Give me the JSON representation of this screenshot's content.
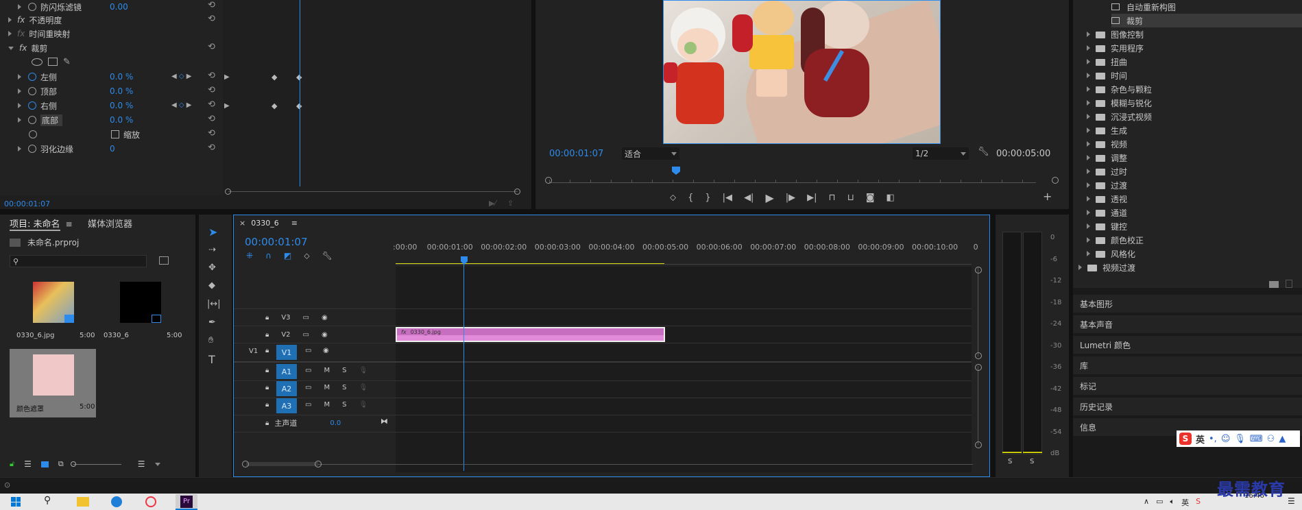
{
  "effect_controls": {
    "rows": [
      {
        "label": "防闪烁滤镜",
        "value": "0.00"
      },
      {
        "label": "不透明度"
      },
      {
        "label": "时间重映射"
      },
      {
        "label": "裁剪"
      },
      {
        "label": "左侧",
        "value": "0.0 %"
      },
      {
        "label": "顶部",
        "value": "0.0 %"
      },
      {
        "label": "右侧",
        "value": "0.0 %"
      },
      {
        "label": "底部",
        "value": "0.0 %"
      },
      {
        "label": "缩放"
      },
      {
        "label": "羽化边缘",
        "value": "0"
      }
    ],
    "timecode": "00:00:01:07",
    "fx_label": "fx"
  },
  "program_monitor": {
    "timecode": "00:00:01:07",
    "fit": "适合",
    "resolution": "1/2",
    "duration": "00:00:05:00"
  },
  "effects_panel": {
    "items": [
      {
        "label": "自动重新构图",
        "level": 2
      },
      {
        "label": "裁剪",
        "level": 2
      },
      {
        "label": "图像控制",
        "level": 1
      },
      {
        "label": "实用程序",
        "level": 1
      },
      {
        "label": "扭曲",
        "level": 1
      },
      {
        "label": "时间",
        "level": 1
      },
      {
        "label": "杂色与颗粒",
        "level": 1
      },
      {
        "label": "模糊与锐化",
        "level": 1
      },
      {
        "label": "沉浸式视频",
        "level": 1
      },
      {
        "label": "生成",
        "level": 1
      },
      {
        "label": "视频",
        "level": 1
      },
      {
        "label": "调整",
        "level": 1
      },
      {
        "label": "过时",
        "level": 1
      },
      {
        "label": "过渡",
        "level": 1
      },
      {
        "label": "透视",
        "level": 1
      },
      {
        "label": "通道",
        "level": 1
      },
      {
        "label": "键控",
        "level": 1
      },
      {
        "label": "颜色校正",
        "level": 1
      },
      {
        "label": "风格化",
        "level": 1
      },
      {
        "label": "视频过渡",
        "level": 0
      }
    ],
    "sections": [
      "基本图形",
      "基本声音",
      "Lumetri 颜色",
      "库",
      "标记",
      "历史记录",
      "信息"
    ]
  },
  "project_panel": {
    "tabs": [
      "项目: 未命名",
      "媒体浏览器"
    ],
    "project_file": "未命名.prproj",
    "clips": [
      {
        "name": "0330_6.jpg",
        "duration": "5:00"
      },
      {
        "name": "0330_6",
        "duration": "5:00"
      },
      {
        "name": "颜色遮罩",
        "duration": "5:00"
      }
    ]
  },
  "timeline": {
    "sequence_name": "0330_6",
    "timecode": "00:00:01:07",
    "ruler": [
      ":00:00",
      "00:00:01:00",
      "00:00:02:00",
      "00:00:03:00",
      "00:00:04:00",
      "00:00:05:00",
      "00:00:06:00",
      "00:00:07:00",
      "00:00:08:00",
      "00:00:09:00",
      "00:00:10:00",
      "0"
    ],
    "video_tracks": [
      "V3",
      "V2",
      "V1"
    ],
    "audio_tracks": [
      "A1",
      "A2",
      "A3"
    ],
    "source_v1": "V1",
    "master_label": "主声道",
    "master_value": "0.0",
    "clip_name": "0330_6.jpg",
    "clip_fx": "fx",
    "m": "M",
    "s": "S"
  },
  "meters": {
    "labels": [
      "0",
      "-6",
      "-12",
      "-18",
      "-24",
      "-30",
      "-36",
      "-42",
      "-48",
      "-54",
      "dB"
    ],
    "solo": [
      "S",
      "S"
    ]
  },
  "ime": {
    "lang": "英"
  },
  "watermark": "最需教育",
  "clock": "16:46",
  "colors": {
    "accent": "#2d8ceb",
    "clip": "#e08ad8",
    "track_btn": "#1f6fb5"
  }
}
